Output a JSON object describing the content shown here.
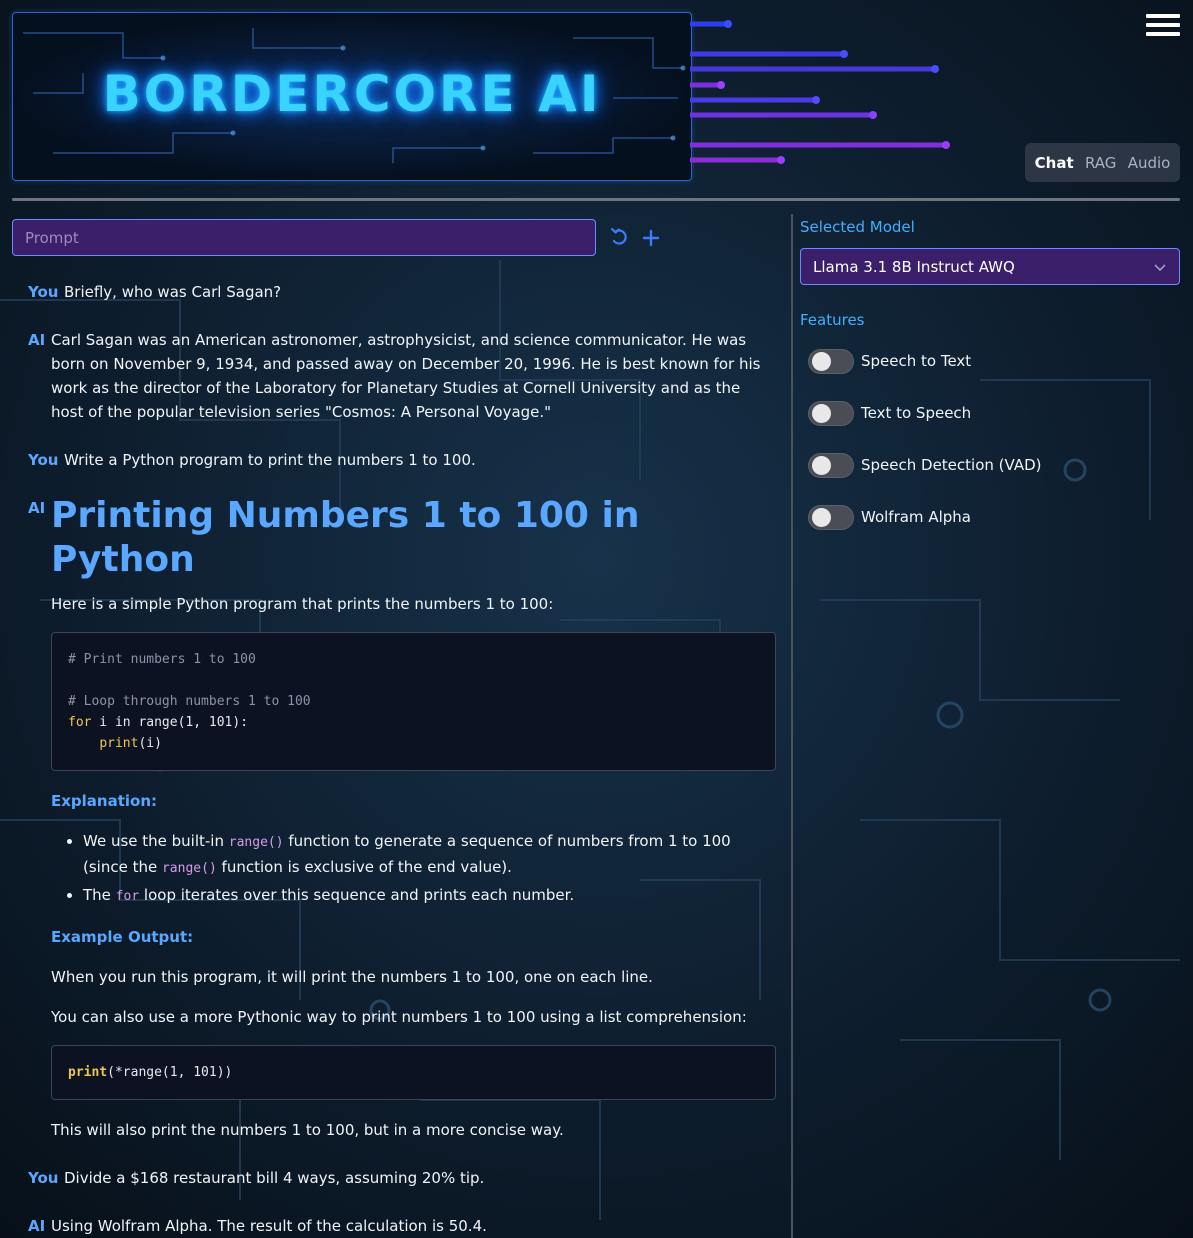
{
  "header": {
    "banner_title": "BORDERCORE AI",
    "menu_icon": "hamburger-menu-icon"
  },
  "mode_tabs": [
    {
      "label": "Chat",
      "active": true
    },
    {
      "label": "RAG",
      "active": false
    },
    {
      "label": "Audio",
      "active": false
    }
  ],
  "prompt": {
    "placeholder": "Prompt",
    "value": "",
    "reset_icon": "reset-icon",
    "add_icon": "plus-icon"
  },
  "chat": {
    "messages": [
      {
        "role": "You",
        "text": "Briefly, who was Carl Sagan?"
      },
      {
        "role": "AI",
        "text": "Carl Sagan was an American astronomer, astrophysicist, and science communicator. He was born on November 9, 1934, and passed away on December 20, 1996. He is best known for his work as the director of the Laboratory for Planetary Studies at Cornell University and as the host of the popular television series \"Cosmos: A Personal Voyage.\""
      },
      {
        "role": "You",
        "text": "Write a Python program to print the numbers 1 to 100."
      },
      {
        "role": "AI",
        "heading": "Printing Numbers 1 to 100 in Python",
        "intro": "Here is a simple Python program that prints the numbers 1 to 100:",
        "code1": {
          "comment1": "# Print numbers 1 to 100",
          "comment2": "# Loop through numbers 1 to 100",
          "for_kw": "for",
          "for_rest": " i in range(1, 101):",
          "indent": "    ",
          "print_kw": "print",
          "print_rest": "(i)"
        },
        "explanation_title": "Explanation:",
        "bullet1_a": "We use the built-in ",
        "bullet1_code": "range()",
        "bullet1_b": " function to generate a sequence of numbers from 1 to 100 (since the ",
        "bullet1_code2": "range()",
        "bullet1_c": " function is exclusive of the end value).",
        "bullet2_a": "The ",
        "bullet2_code": "for",
        "bullet2_b": " loop iterates over this sequence and prints each number.",
        "example_title": "Example Output:",
        "para1": "When you run this program, it will print the numbers 1 to 100, one on each line.",
        "para2": "You can also use a more Pythonic way to print numbers 1 to 100 using a list comprehension:",
        "code2": {
          "print_kw": "print",
          "rest": "(*range(1, 101))"
        },
        "para3": "This will also print the numbers 1 to 100, but in a more concise way."
      },
      {
        "role": "You",
        "text": "Divide a $168 restaurant bill 4 ways, assuming 20% tip."
      },
      {
        "role": "AI",
        "text": "Using Wolfram Alpha. The result of the calculation is 50.4."
      }
    ]
  },
  "sidebar": {
    "model_label": "Selected Model",
    "model_value": "Llama 3.1 8B Instruct AWQ",
    "features_label": "Features",
    "features": [
      {
        "label": "Speech to Text",
        "enabled": false
      },
      {
        "label": "Text to Speech",
        "enabled": false
      },
      {
        "label": "Speech Detection (VAD)",
        "enabled": false
      },
      {
        "label": "Wolfram Alpha",
        "enabled": false
      }
    ]
  },
  "colors": {
    "accent": "#5aa7ff",
    "input_bg": "#3b1f6a",
    "input_border": "#6a8cff",
    "code_keyword": "#f0c84a",
    "inline_code": "#d79aea"
  }
}
